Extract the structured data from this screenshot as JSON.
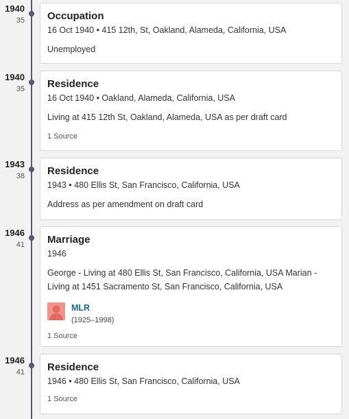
{
  "colors": {
    "timeline": "#5b5673",
    "card_bg": "#ffffff",
    "link": "#1a6c8a",
    "avatar_bg": "#f2938e"
  },
  "events": [
    {
      "year": "1940",
      "age": "35",
      "title": "Occupation",
      "meta": "16 Oct 1940 • 415 12th, St, Oakland, Alameda, California, USA",
      "description": "Unemployed",
      "source": ""
    },
    {
      "year": "1940",
      "age": "35",
      "title": "Residence",
      "meta": "16 Oct 1940 • Oakland, Alameda, California, USA",
      "description": "Living at 415 12th St, Oakland, Alameda, USA as per draft card",
      "source": "1 Source"
    },
    {
      "year": "1943",
      "age": "38",
      "title": "Residence",
      "meta": "1943 • 480 Ellis St, San Francisco, California, USA",
      "description": "Address as per amendment on draft card",
      "source": ""
    },
    {
      "year": "1946",
      "age": "41",
      "title": "Marriage",
      "meta": "1946",
      "description_line1": "George - Living at 480 Ellis St, San Francisco, California, USA Marian -",
      "description_line2": "Living at 1451 Sacramento St, San Francisco, California, USA",
      "spouse": {
        "name": "MLR",
        "dates": "(1925–1998)",
        "icon": "person-silhouette-icon"
      },
      "source": "1 Source"
    },
    {
      "year": "1946",
      "age": "41",
      "title": "Residence",
      "meta": "1946 • 480 Ellis St, San Francisco, California, USA",
      "description": "",
      "source": "1 Source"
    }
  ]
}
